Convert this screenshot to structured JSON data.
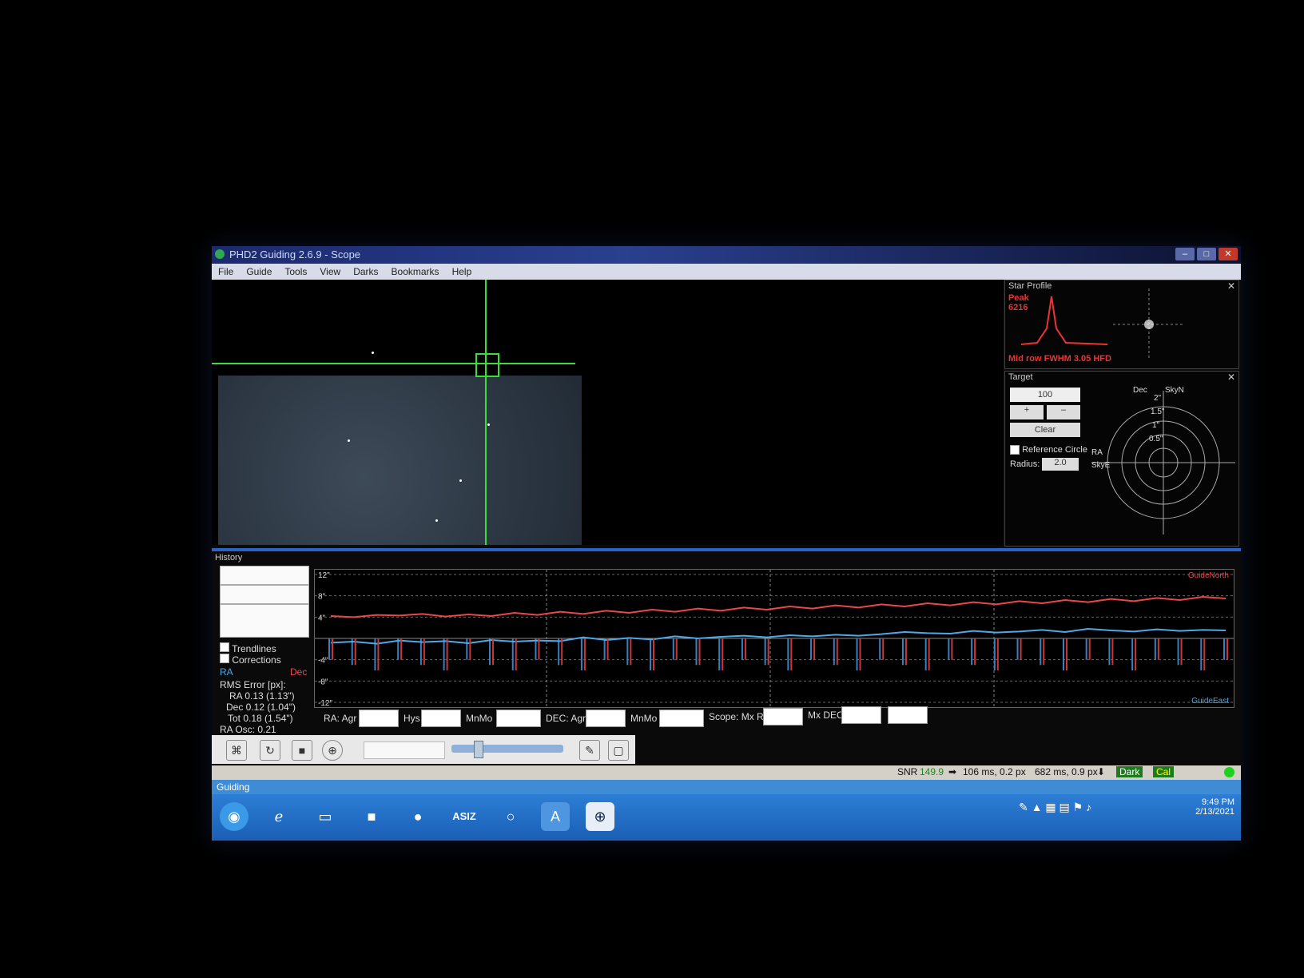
{
  "window": {
    "title": "PHD2 Guiding 2.6.9 - Scope"
  },
  "menu": [
    "File",
    "Guide",
    "Tools",
    "View",
    "Darks",
    "Bookmarks",
    "Help"
  ],
  "star_profile": {
    "title": "Star Profile",
    "peak_label": "Peak",
    "peak_value": "6216",
    "footer": "Mid row FWHM 3.05 HFD"
  },
  "target": {
    "title": "Target",
    "dropdown": "100",
    "clear": "Clear",
    "ref_circle": "Reference Circle",
    "radius_label": "Radius:",
    "radius_value": "2.0",
    "labels": {
      "dec": "Dec",
      "skyn": "SkyN",
      "ra": "RA",
      "skye": "SkyE"
    },
    "rings": [
      "2\"",
      "1.5\"",
      "1\"",
      "0.5\""
    ]
  },
  "history": {
    "title": "History",
    "corner_top": "GuideNorth",
    "corner_bottom": "GuideEast",
    "trendlines": "Trendlines",
    "corrections": "Corrections",
    "ra_label": "RA",
    "dec_label": "Dec",
    "rms_title": "RMS Error [px]:",
    "ra_rms": "RA 0.13 (1.13\")",
    "dec_rms": "Dec 0.12 (1.04\")",
    "tot_rms": "Tot 0.18 (1.54\")",
    "ra_osc": "RA Osc: 0.21",
    "y_ticks": [
      "12\"",
      "8\"",
      "4\"",
      "-4\"",
      "-8\"",
      "-12\""
    ]
  },
  "params": {
    "ra_agr": "RA: Agr",
    "hys": "Hys",
    "mnmo": "MnMo",
    "dec_agr": "DEC: Agr",
    "mnmo2": "MnMo",
    "scope_mxra": "Scope: Mx RA",
    "mxdec": "Mx DEC"
  },
  "status": {
    "snr_label": "SNR",
    "snr_value": "149.9",
    "exp1": "106 ms, 0.2 px",
    "exp2": "682 ms, 0.9 px",
    "dark": "Dark",
    "cal": "Cal"
  },
  "app_status": "Guiding",
  "taskbar": {
    "time": "9:49 PM",
    "date": "2/13/2021",
    "asiz": "ASIZ"
  },
  "chart_data": {
    "type": "line",
    "ylim": [
      -12,
      12
    ],
    "series": [
      {
        "name": "RA",
        "values": [
          -0.8,
          -0.6,
          -1.0,
          -0.4,
          -0.7,
          -0.5,
          -0.9,
          -0.3,
          -0.6,
          -0.4,
          -0.5,
          0.2,
          -0.3,
          0.1,
          -0.2,
          0.4,
          0.0,
          0.3,
          0.5,
          0.2,
          0.6,
          0.4,
          0.7,
          0.5,
          0.8,
          1.2,
          1.0,
          0.9,
          1.4,
          1.1,
          1.3,
          1.6,
          1.2,
          1.8,
          1.5,
          1.3,
          1.7,
          1.4,
          1.6,
          1.5
        ]
      },
      {
        "name": "Dec",
        "values": [
          4.2,
          4.0,
          4.4,
          4.3,
          4.6,
          4.1,
          4.5,
          4.2,
          4.8,
          4.4,
          5.0,
          4.6,
          5.2,
          4.8,
          5.4,
          5.0,
          5.6,
          5.2,
          5.8,
          5.4,
          6.0,
          5.6,
          6.2,
          5.8,
          6.4,
          6.0,
          6.6,
          6.2,
          6.8,
          6.4,
          7.0,
          6.6,
          7.2,
          6.8,
          7.4,
          7.0,
          7.6,
          7.2,
          7.8,
          7.5
        ]
      }
    ]
  }
}
